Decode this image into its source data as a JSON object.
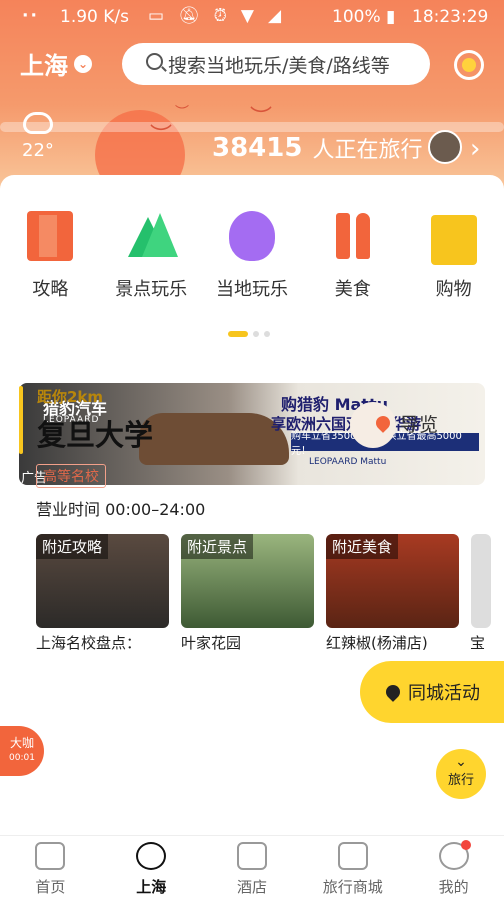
{
  "status_bar": {
    "dots": "··",
    "speed": "1.90 K/s",
    "battery": "100%",
    "time": "18:23:29"
  },
  "header": {
    "city": "上海",
    "search_placeholder": "搜索当地玩乐/美食/路线等",
    "temperature": "22°",
    "travelers_count": "38415",
    "travelers_text": "人正在旅行"
  },
  "categories": [
    {
      "label": "攻略",
      "icon": "guide-book-icon"
    },
    {
      "label": "景点玩乐",
      "icon": "mountain-icon"
    },
    {
      "label": "当地玩乐",
      "icon": "balloon-icon"
    },
    {
      "label": "美食",
      "icon": "fork-spoon-icon"
    },
    {
      "label": "购物",
      "icon": "shopping-bag-icon"
    }
  ],
  "ad": {
    "brand": "猎豹汽车",
    "brand_en": "LEOPAARD",
    "title": "购猎豹 Mattu",
    "subtitle": "享欧洲六国双人豪华游",
    "bar_text": "购车立省3500元，置换立省最高5000元！",
    "logo_text": "LEOPAARD Mattu",
    "tag": "广告"
  },
  "poi": {
    "distance": "距你2km",
    "name": "复旦大学",
    "guide_label": "导览",
    "tag": "高等名校",
    "hours": "营业时间 00:00–24:00",
    "tiles": [
      {
        "label": "附近攻略",
        "caption": "上海名校盘点："
      },
      {
        "label": "附近景点",
        "caption": "叶家花园"
      },
      {
        "label": "附近美食",
        "caption": "红辣椒(杨浦店)"
      },
      {
        "label": "",
        "caption": "宝"
      }
    ]
  },
  "fabs": {
    "activity": "同城活动",
    "trip": "旅行",
    "side_label": "大咖",
    "side_time": "00:01"
  },
  "nav": [
    {
      "label": "首页",
      "icon": "home-icon"
    },
    {
      "label": "上海",
      "icon": "location-icon"
    },
    {
      "label": "酒店",
      "icon": "hotel-icon"
    },
    {
      "label": "旅行商城",
      "icon": "palm-tree-icon"
    },
    {
      "label": "我的",
      "icon": "profile-icon"
    }
  ],
  "colors": {
    "accent": "#f5835a",
    "yellow": "#ffd52e"
  }
}
